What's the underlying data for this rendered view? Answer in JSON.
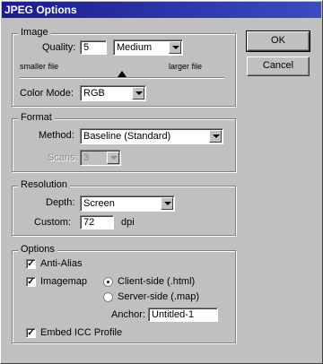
{
  "window": {
    "title": "JPEG Options"
  },
  "buttons": {
    "ok": "OK",
    "cancel": "Cancel"
  },
  "image": {
    "legend": "Image",
    "quality_label": "Quality:",
    "quality_value": "5",
    "quality_preset": "Medium",
    "smaller_file": "smaller file",
    "larger_file": "larger file",
    "quality_slider_level": 5,
    "color_mode_label": "Color Mode:",
    "color_mode_value": "RGB"
  },
  "format": {
    "legend": "Format",
    "method_label": "Method:",
    "method_value": "Baseline (Standard)",
    "scans_label": "Scans:",
    "scans_value": "3"
  },
  "resolution": {
    "legend": "Resolution",
    "depth_label": "Depth:",
    "depth_value": "Screen",
    "custom_label": "Custom:",
    "custom_value": "72",
    "custom_unit": "dpi"
  },
  "options": {
    "legend": "Options",
    "anti_alias": "Anti-Alias",
    "imagemap": "Imagemap",
    "client_side": "Client-side (.html)",
    "server_side": "Server-side (.map)",
    "anchor_label": "Anchor:",
    "anchor_value": "Untitled-1",
    "embed_icc": "Embed ICC Profile"
  }
}
